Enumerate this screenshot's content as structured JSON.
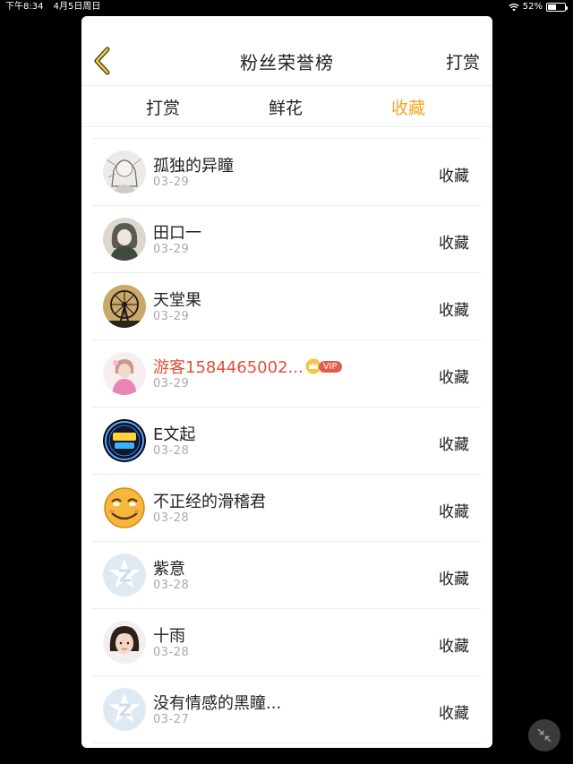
{
  "status_bar": {
    "time": "下午8:34",
    "date": "4月5日周日",
    "battery": "52%"
  },
  "header": {
    "title": "粉丝荣誉榜",
    "action_label": "打赏"
  },
  "tabs": [
    {
      "label": "打赏",
      "active": false
    },
    {
      "label": "鲜花",
      "active": false
    },
    {
      "label": "收藏",
      "active": true
    }
  ],
  "rows": [
    {
      "name": "孤独的异瞳",
      "date": "03-29",
      "action": "收藏",
      "avatar": "sketch-girl"
    },
    {
      "name": "田口一",
      "date": "03-29",
      "action": "收藏",
      "avatar": "anime-girl-dark"
    },
    {
      "name": "天堂果",
      "date": "03-29",
      "action": "收藏",
      "avatar": "ferris-wheel"
    },
    {
      "name": "游客1584465002...",
      "date": "03-29",
      "action": "收藏",
      "avatar": "pink-girl",
      "vip": true,
      "vip_label": "VIP"
    },
    {
      "name": "E文起",
      "date": "03-28",
      "action": "收藏",
      "avatar": "neon-logo"
    },
    {
      "name": "不正经的滑稽君",
      "date": "03-28",
      "action": "收藏",
      "avatar": "funny-face"
    },
    {
      "name": "紫意",
      "date": "03-28",
      "action": "收藏",
      "avatar": "qq-default"
    },
    {
      "name": "十雨",
      "date": "03-28",
      "action": "收藏",
      "avatar": "child-photo"
    },
    {
      "name": "没有情感的黑瞳...",
      "date": "03-27",
      "action": "收藏",
      "avatar": "qq-default"
    }
  ],
  "colors": {
    "accent": "#f4a623",
    "vip_name": "#e04e3a",
    "vip_badge": "#e65a4e"
  }
}
